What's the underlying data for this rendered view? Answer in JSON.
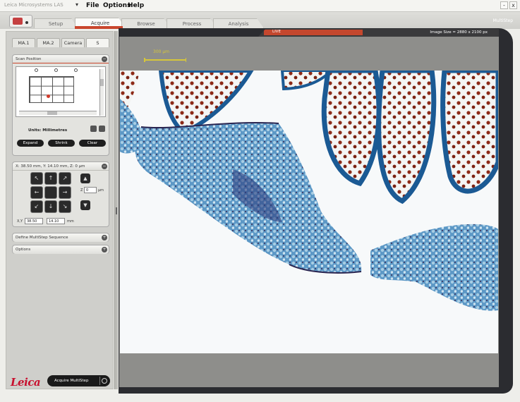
{
  "menubar": {
    "app_name": "Leica Microsystems LAS",
    "app_dropdown_icon": "caret-down-icon",
    "menus": [
      "File",
      "Options",
      "Help"
    ],
    "minimize_label": "-",
    "close_label": "x"
  },
  "tabs": {
    "items": [
      "Setup",
      "Acquire",
      "Browse",
      "Process",
      "Analysis"
    ],
    "active": "Acquire",
    "brand_label": "MultiStep",
    "accent_color": "#c9462d"
  },
  "left_panel": {
    "subtabs": [
      "MA.1",
      "MA.2",
      "Camera",
      "S"
    ],
    "active_subtab": "S",
    "scan_position": {
      "title": "Scan Position",
      "units_label": "Units: Millimetres",
      "buttons": {
        "expand": "Expand",
        "shrink": "Shrink",
        "clear": "Clear"
      }
    },
    "position": {
      "title": "X: 38.50 mm, Y: 14.10 mm, Z: 0 µm",
      "z_label": "Z",
      "z_value": "0",
      "z_unit": "µm",
      "xy_label": "X,Y",
      "x_value": "38.50",
      "y_value": "14.10",
      "xy_unit": "mm",
      "pad_arrows": [
        "↖",
        "↑",
        "↗",
        "←",
        "",
        "→",
        "↙",
        "↓",
        "↘"
      ],
      "z_up": "▲",
      "z_down": "▼"
    },
    "define_section": {
      "title": "Define MultiStep Sequence"
    },
    "options_section": {
      "title": "Options"
    },
    "logo_text": "Leica",
    "acquire_button": "Acquire MultiStep"
  },
  "viewer": {
    "live_label": "LIVE",
    "image_size": "Image Size = 2880 x 2100 px",
    "scale_label": "300 µm",
    "image_alt": "microscope-tissue-image"
  }
}
